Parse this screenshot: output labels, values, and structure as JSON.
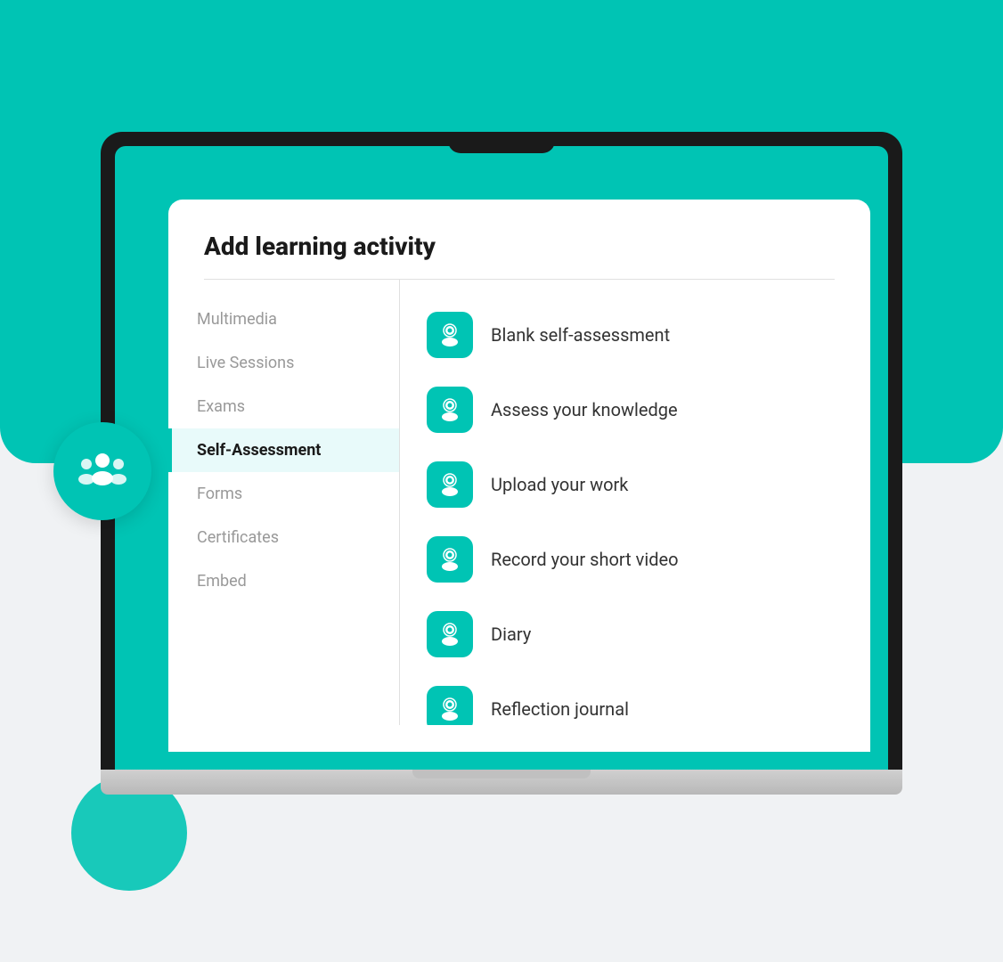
{
  "scene": {
    "background_color": "#f0f2f4",
    "teal_color": "#00c4b4"
  },
  "dialog": {
    "title": "Add learning activity",
    "sidebar": {
      "items": [
        {
          "id": "multimedia",
          "label": "Multimedia",
          "active": false
        },
        {
          "id": "live-sessions",
          "label": "Live Sessions",
          "active": false
        },
        {
          "id": "exams",
          "label": "Exams",
          "active": false
        },
        {
          "id": "self-assessment",
          "label": "Self-Assessment",
          "active": true
        },
        {
          "id": "forms",
          "label": "Forms",
          "active": false
        },
        {
          "id": "certificates",
          "label": "Certificates",
          "active": false
        },
        {
          "id": "embed",
          "label": "Embed",
          "active": false
        }
      ]
    },
    "activities": [
      {
        "id": "blank-self-assessment",
        "label": "Blank self-assessment"
      },
      {
        "id": "assess-knowledge",
        "label": "Assess your knowledge"
      },
      {
        "id": "upload-work",
        "label": "Upload your work"
      },
      {
        "id": "record-video",
        "label": "Record your short video"
      },
      {
        "id": "diary",
        "label": "Diary"
      },
      {
        "id": "reflection-journal",
        "label": "Reflection journal"
      }
    ]
  },
  "avatar": {
    "icon": "users-icon"
  }
}
